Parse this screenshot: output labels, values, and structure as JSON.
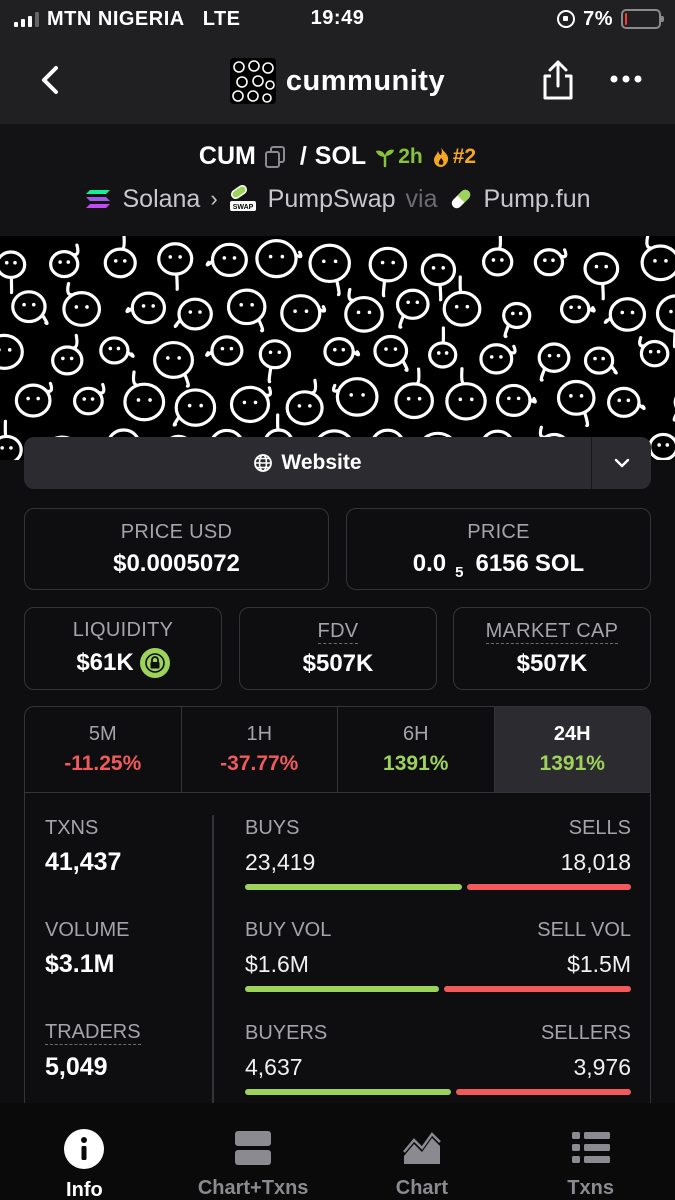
{
  "status_bar": {
    "carrier": "MTN NIGERIA",
    "network": "LTE",
    "time": "19:49",
    "battery_text": "7%",
    "battery_level": 0.07
  },
  "header": {
    "title": "cummunity",
    "icons": [
      "back-icon",
      "share-icon",
      "more-icon"
    ]
  },
  "pair": {
    "base": "CUM",
    "separator": "/",
    "quote": "SOL",
    "age": "2h",
    "rank": "#2",
    "chain": "Solana",
    "dex": "PumpSwap",
    "via_label": "via",
    "launchpad": "Pump.fun",
    "dex_badge": "SWAP"
  },
  "website": {
    "label": "Website"
  },
  "stats": {
    "price_usd": {
      "label": "PRICE USD",
      "value": "$0.0005072"
    },
    "price_native": {
      "label": "PRICE",
      "prefix": "0.0",
      "zeros": "5",
      "digits": "6156",
      "unit": "SOL"
    },
    "liquidity": {
      "label": "LIQUIDITY",
      "value": "$61K"
    },
    "fdv": {
      "label": "FDV",
      "value": "$507K"
    },
    "market_cap": {
      "label": "MARKET CAP",
      "value": "$507K"
    }
  },
  "timeframes": [
    {
      "label": "5M",
      "change": "-11.25%",
      "direction": "down"
    },
    {
      "label": "1H",
      "change": "-37.77%",
      "direction": "down"
    },
    {
      "label": "6H",
      "change": "1391%",
      "direction": "up"
    },
    {
      "label": "24H",
      "change": "1391%",
      "direction": "up",
      "active": true
    }
  ],
  "activity": {
    "txns": {
      "label": "TXNS",
      "value": "41,437"
    },
    "volume": {
      "label": "VOLUME",
      "value": "$3.1M"
    },
    "traders": {
      "label": "TRADERS",
      "value": "5,049"
    },
    "buys_sells": {
      "left_label": "BUYS",
      "right_label": "SELLS",
      "left_value": "23,419",
      "right_value": "18,018"
    },
    "vol_split": {
      "left_label": "BUY VOL",
      "right_label": "SELL VOL",
      "left_value": "$1.6M",
      "right_value": "$1.5M"
    },
    "buyers_sellers": {
      "left_label": "BUYERS",
      "right_label": "SELLERS",
      "left_value": "4,637",
      "right_value": "3,976"
    }
  },
  "tabbar": {
    "tabs": [
      {
        "label": "Info",
        "icon": "info-icon",
        "active": true
      },
      {
        "label": "Chart+Txns",
        "icon": "chart-txns-icon"
      },
      {
        "label": "Chart",
        "icon": "chart-icon"
      },
      {
        "label": "Txns",
        "icon": "list-icon"
      }
    ]
  },
  "colors": {
    "positive": "#9ed35b",
    "negative": "#f05a5a",
    "age": "#86c23a",
    "rank": "#f5a623",
    "background": "#0e0e10"
  }
}
